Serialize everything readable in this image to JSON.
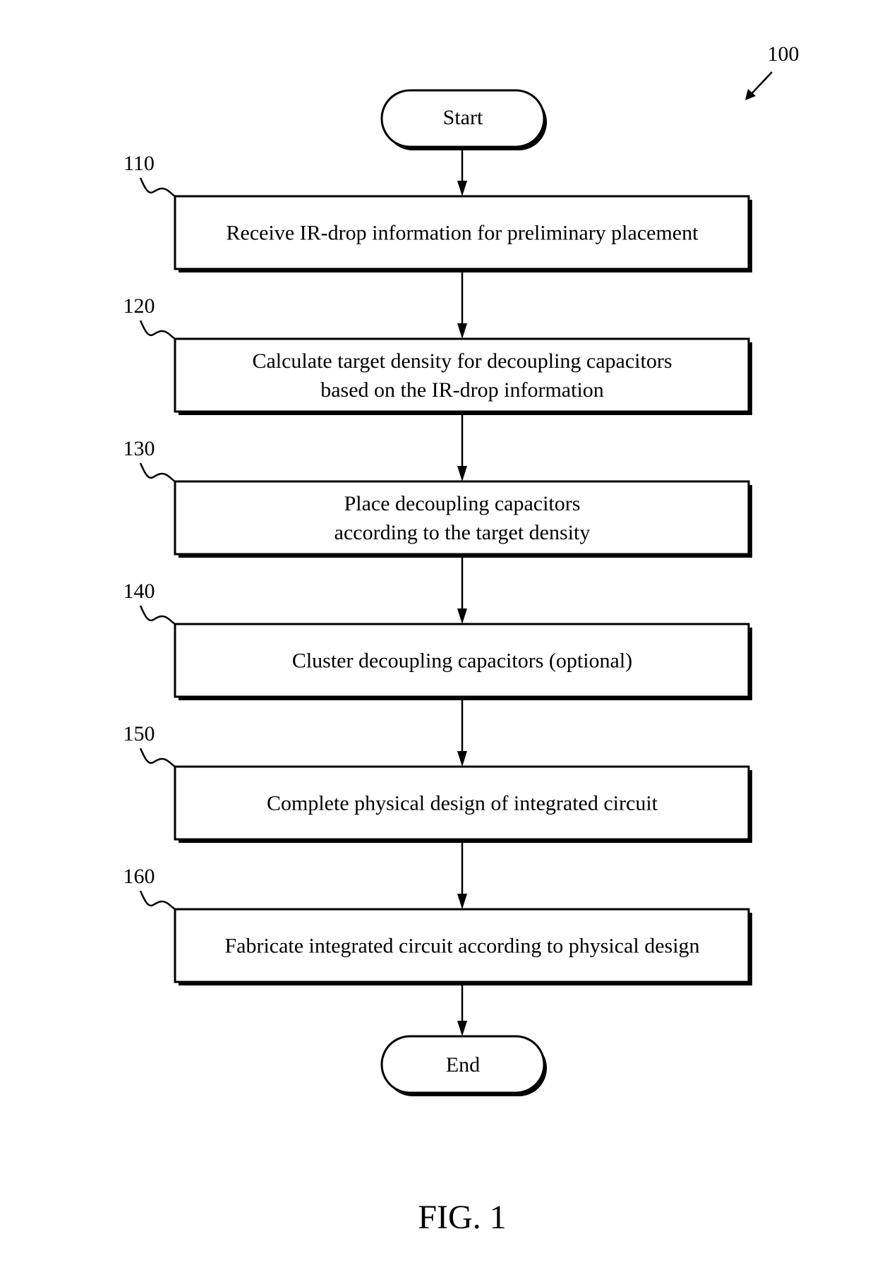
{
  "figure": {
    "reference_number": "100",
    "caption": "FIG. 1"
  },
  "start": {
    "label": "Start"
  },
  "end": {
    "label": "End"
  },
  "steps": [
    {
      "ref": "110",
      "lines": [
        "Receive IR-drop information for preliminary placement"
      ]
    },
    {
      "ref": "120",
      "lines": [
        "Calculate target density for decoupling capacitors",
        "based on the IR-drop information"
      ]
    },
    {
      "ref": "130",
      "lines": [
        "Place decoupling capacitors",
        "according to the target density"
      ]
    },
    {
      "ref": "140",
      "lines": [
        "Cluster decoupling capacitors (optional)"
      ]
    },
    {
      "ref": "150",
      "lines": [
        "Complete physical design of integrated circuit"
      ]
    },
    {
      "ref": "160",
      "lines": [
        "Fabricate integrated circuit according to physical design"
      ]
    }
  ]
}
